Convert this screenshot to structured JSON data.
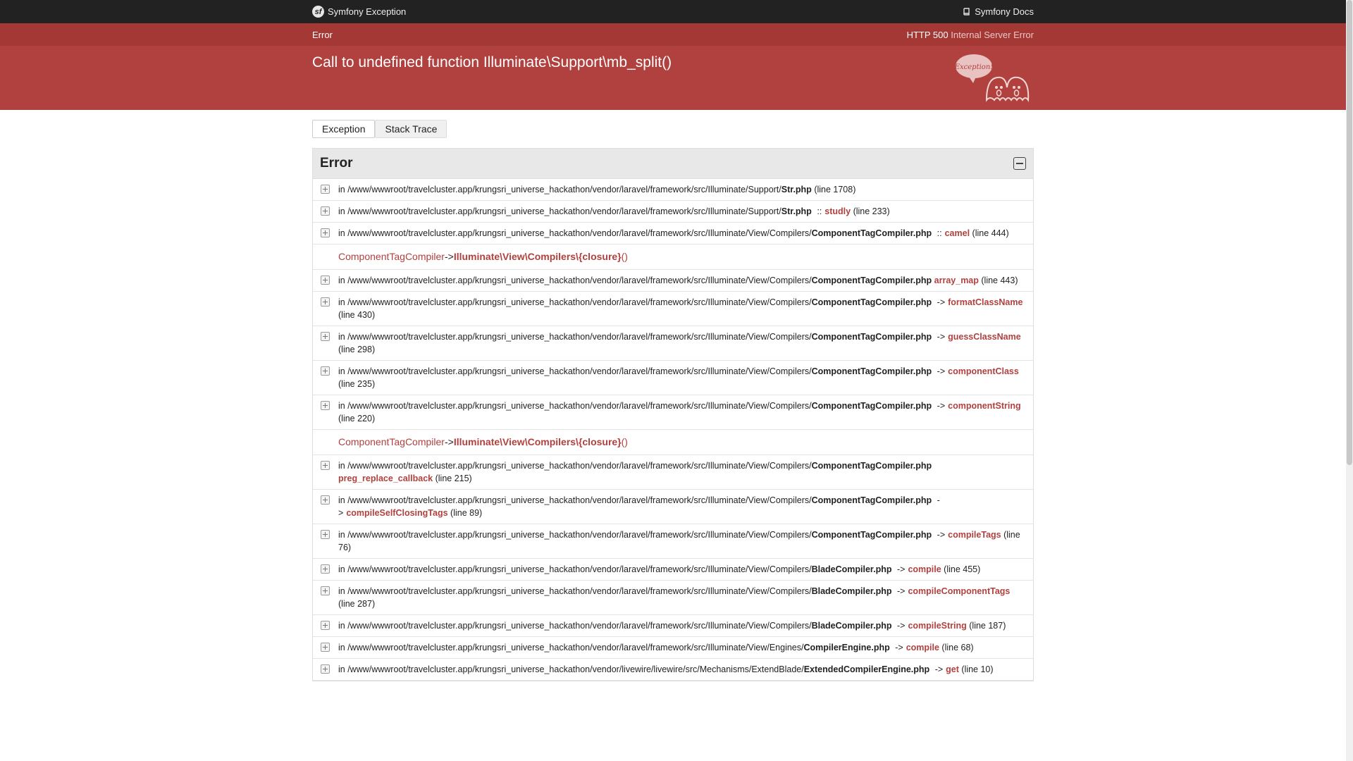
{
  "header": {
    "app_title": "Symfony Exception",
    "docs_link": "Symfony Docs"
  },
  "summary": {
    "label": "Error",
    "status_code": "HTTP 500",
    "status_text": "Internal Server Error",
    "message": "Call to undefined function Illuminate\\Support\\mb_split()",
    "ghost_text": "Exception!"
  },
  "tabs": [
    {
      "label": "Exception"
    },
    {
      "label": "Stack Trace"
    }
  ],
  "trace": {
    "title": "Error",
    "base_path": "in /www/wwwroot/travelcluster.app/krungsri_universe_hackathon/vendor/laravel/framework/src/Illuminate/",
    "rows": [
      {
        "dir": "Support/",
        "file": "Str.php",
        "sep": "",
        "fn": "",
        "line": "(line 1708)"
      },
      {
        "dir": "Support/",
        "file": "Str.php",
        "sep": "::",
        "fn": "studly",
        "line": "(line 233)"
      },
      {
        "dir": "View/Compilers/",
        "file": "ComponentTagCompiler.php",
        "sep": "::",
        "fn": "camel",
        "line": "(line 444)"
      },
      {
        "closure_class": "ComponentTagCompiler",
        "closure_arrow": "->",
        "closure_fn": "Illuminate\\View\\Compilers\\{closure}",
        "closure_args": "()"
      },
      {
        "dir": "View/Compilers/",
        "file": "ComponentTagCompiler.php",
        "sep": "",
        "fn": "array_map",
        "line": "(line 443)"
      },
      {
        "dir": "View/Compilers/",
        "file": "ComponentTagCompiler.php",
        "sep": "->",
        "fn": "formatClassName",
        "line": "(line 430)"
      },
      {
        "dir": "View/Compilers/",
        "file": "ComponentTagCompiler.php",
        "sep": "->",
        "fn": "guessClassName",
        "line": "(line 298)"
      },
      {
        "dir": "View/Compilers/",
        "file": "ComponentTagCompiler.php",
        "sep": "->",
        "fn": "componentClass",
        "line": "(line 235)"
      },
      {
        "dir": "View/Compilers/",
        "file": "ComponentTagCompiler.php",
        "sep": "->",
        "fn": "componentString",
        "line": "(line 220)"
      },
      {
        "closure_class": "ComponentTagCompiler",
        "closure_arrow": "->",
        "closure_fn": "Illuminate\\View\\Compilers\\{closure}",
        "closure_args": "()"
      },
      {
        "dir": "View/Compilers/",
        "file": "ComponentTagCompiler.php",
        "sep": "",
        "fn": "preg_replace_callback",
        "line": "(line 215)"
      },
      {
        "dir": "View/Compilers/",
        "file": "ComponentTagCompiler.php",
        "sep": "->",
        "fn": "compileSelfClosingTags",
        "line": "(line 89)"
      },
      {
        "dir": "View/Compilers/",
        "file": "ComponentTagCompiler.php",
        "sep": "->",
        "fn": "compileTags",
        "line": "(line 76)"
      },
      {
        "dir": "View/Compilers/",
        "file": "BladeCompiler.php",
        "sep": "->",
        "fn": "compile",
        "line": "(line 455)"
      },
      {
        "dir": "View/Compilers/",
        "file": "BladeCompiler.php",
        "sep": "->",
        "fn": "compileComponentTags",
        "line": "(line 287)"
      },
      {
        "dir": "View/Compilers/",
        "file": "BladeCompiler.php",
        "sep": "->",
        "fn": "compileString",
        "line": "(line 187)"
      },
      {
        "dir": "View/Engines/",
        "file": "CompilerEngine.php",
        "sep": "->",
        "fn": "compile",
        "line": "(line 68)"
      },
      {
        "full_path": "in /www/wwwroot/travelcluster.app/krungsri_universe_hackathon/vendor/livewire/livewire/src/Mechanisms/ExtendBlade/",
        "file": "ExtendedCompilerEngine.php",
        "sep": "->",
        "fn": "get",
        "line": "(line 10)"
      }
    ]
  }
}
